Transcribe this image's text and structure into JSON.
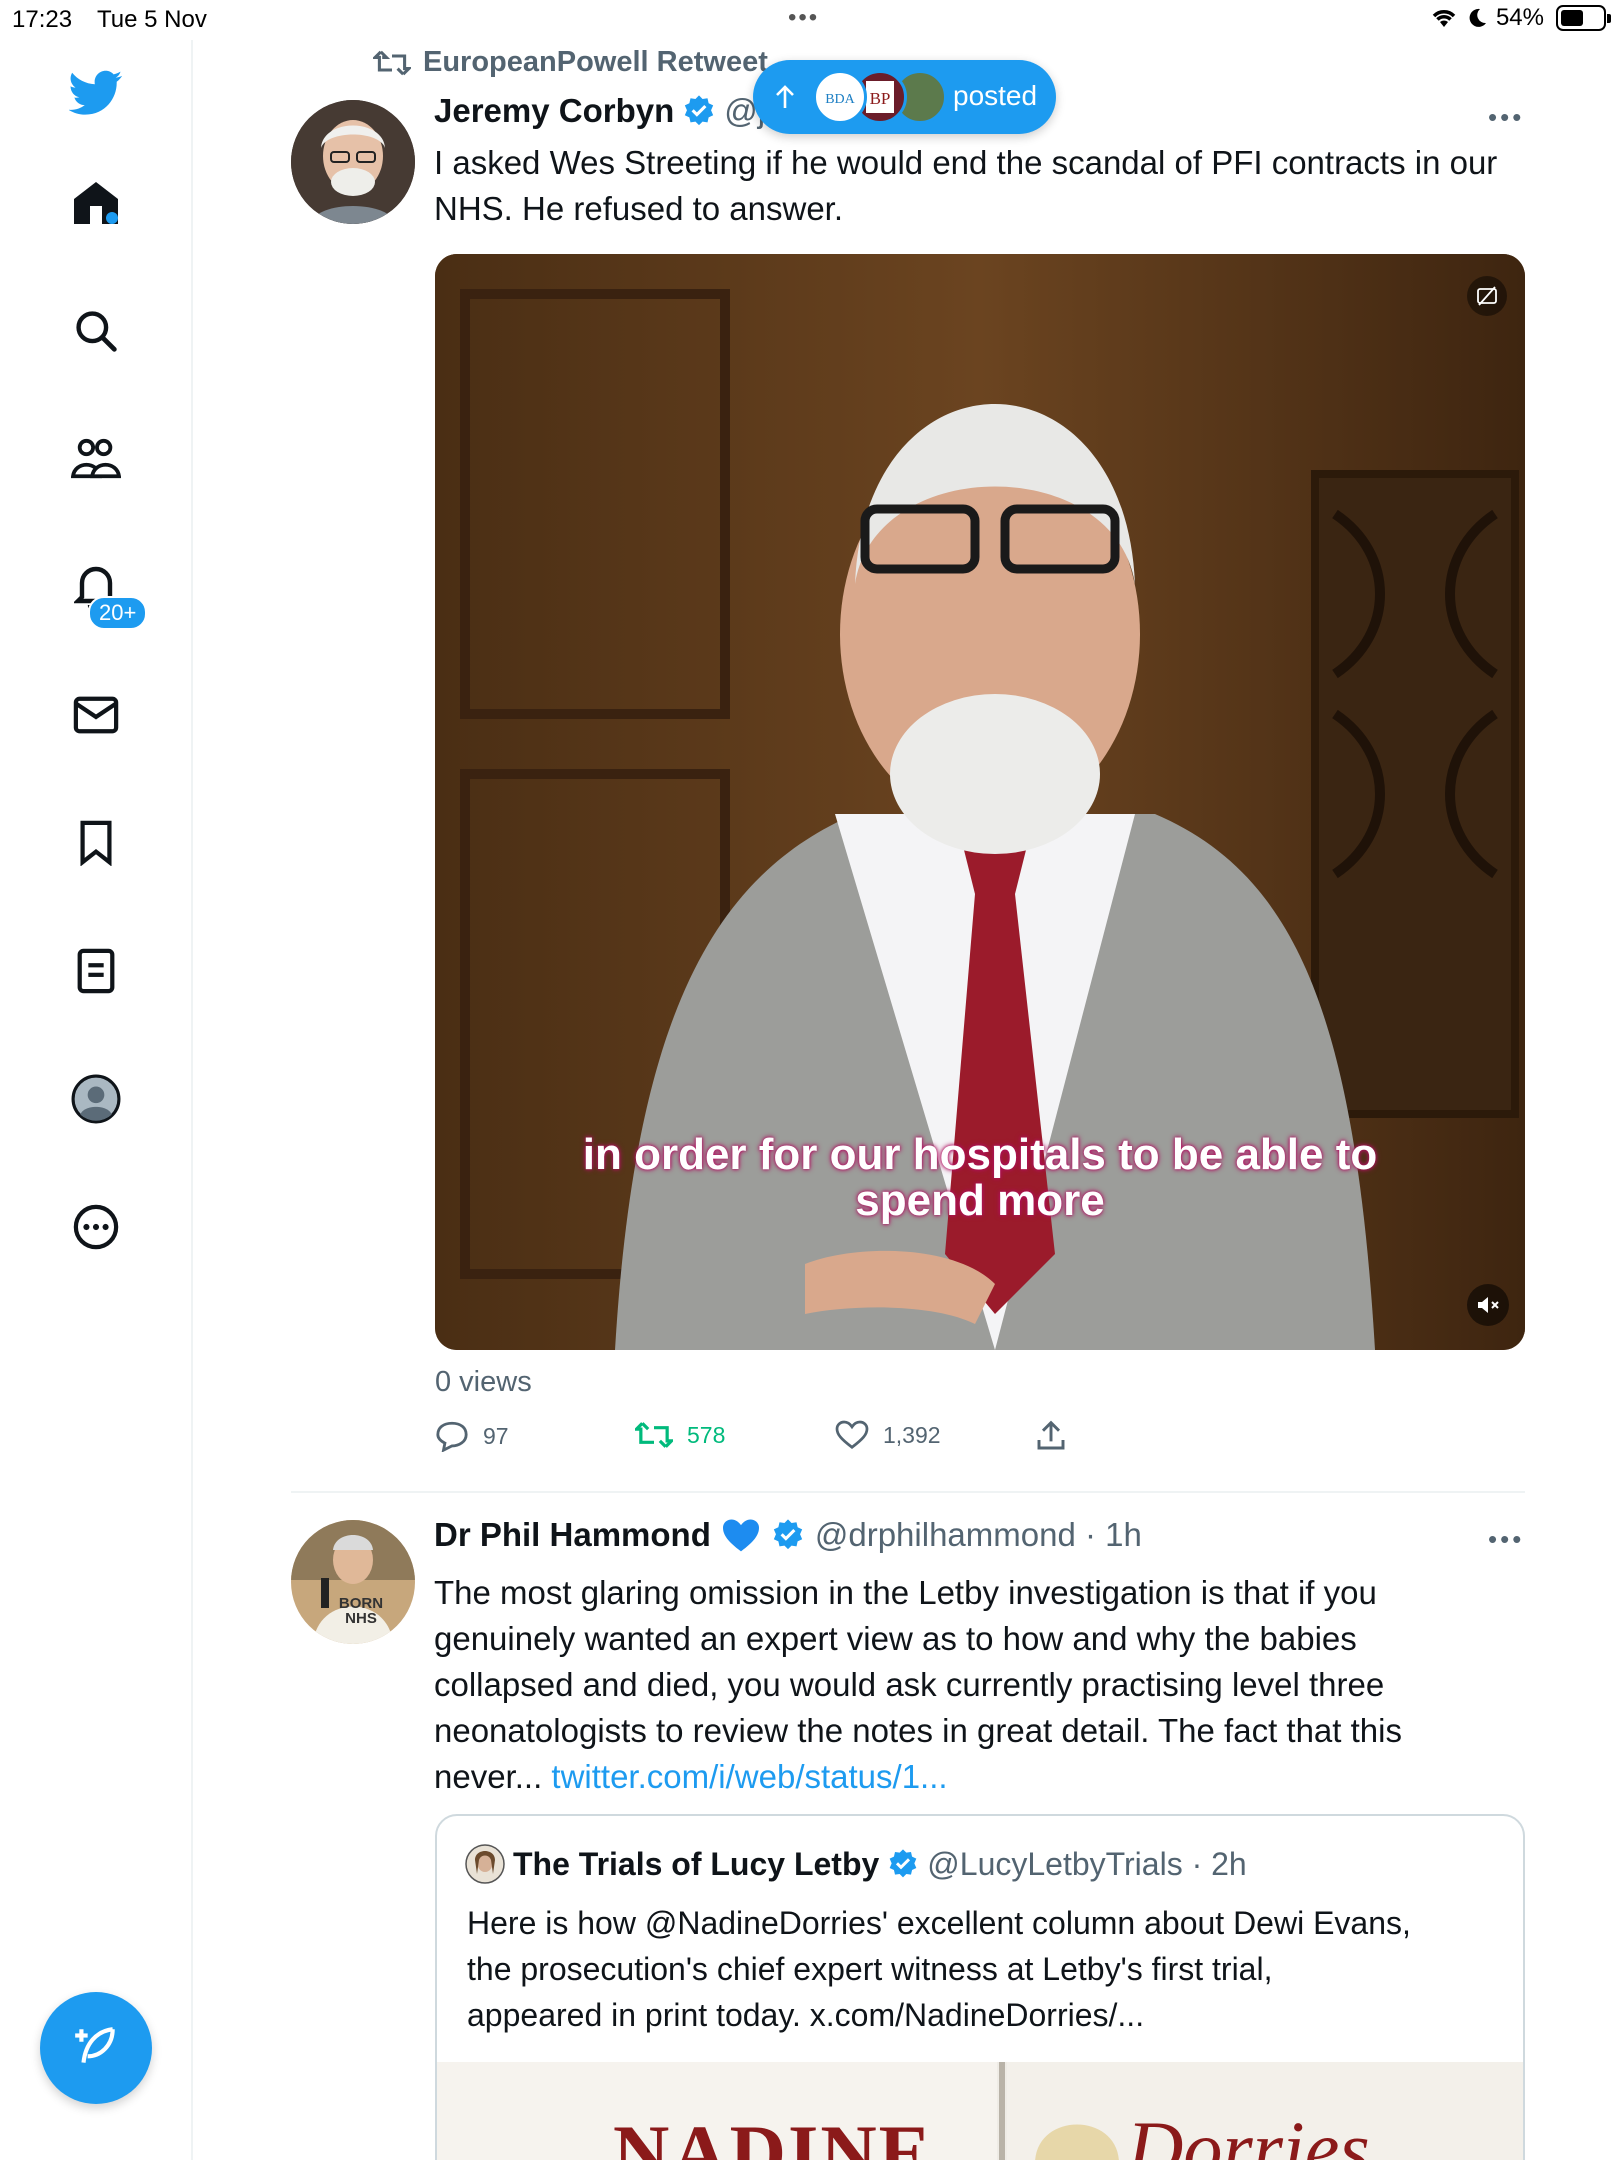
{
  "status_bar": {
    "time": "17:23",
    "date": "Tue 5 Nov",
    "battery": "54%",
    "battery_level": 0.54
  },
  "sidebar": {
    "items": [
      {
        "name": "twitter-logo-icon"
      },
      {
        "name": "home-icon"
      },
      {
        "name": "search-icon"
      },
      {
        "name": "communities-icon"
      },
      {
        "name": "notifications-icon",
        "badge": "20+"
      },
      {
        "name": "messages-icon"
      },
      {
        "name": "bookmarks-icon"
      },
      {
        "name": "lists-icon"
      },
      {
        "name": "profile-icon"
      },
      {
        "name": "more-icon"
      }
    ],
    "compose_icon": "compose-icon"
  },
  "pill": {
    "label": "posted"
  },
  "tweet1": {
    "retweeted_by": "EuropeanPowell Retweet",
    "author": "Jeremy Corbyn",
    "handle": "@j",
    "text": "I asked Wes Streeting if he would end the scandal of PFI contracts in our NHS.  He refused to answer.",
    "caption_line1": "in order for our hospitals to be able to",
    "caption_line2": "spend more",
    "views": "0 views",
    "replies": "97",
    "retweets": "578",
    "likes": "1,392"
  },
  "tweet2": {
    "author": "Dr Phil Hammond",
    "handle_time": "@drphilhammond · 1h",
    "text_line1": "The most glaring omission in the Letby investigation is that if you",
    "text_line2": "genuinely wanted an expert view as to how and why the babies",
    "text_line3": "collapsed and died, you would ask currently practising level three",
    "text_line4": "neonatologists to review the notes in great detail. The fact that this",
    "text_line5": "never... ",
    "link": "twitter.com/i/web/status/1...",
    "avatar_shirt_text": "BORN NHS"
  },
  "quote": {
    "author": "The Trials of Lucy Letby",
    "handle_time": "@LucyLetbyTrials · 2h",
    "text_line1": "Here is how @NadineDorries' excellent column about Dewi Evans,",
    "text_line2": "the prosecution's chief expert witness at Letby's first trial,",
    "text_line3": "appeared in print today. x.com/NadineDorries/...",
    "paper_left": "NADINE",
    "paper_right": "Dorries"
  },
  "colors": {
    "accent": "#1d9bf0",
    "retweet_green": "#00ba7c",
    "muted": "#536471"
  }
}
